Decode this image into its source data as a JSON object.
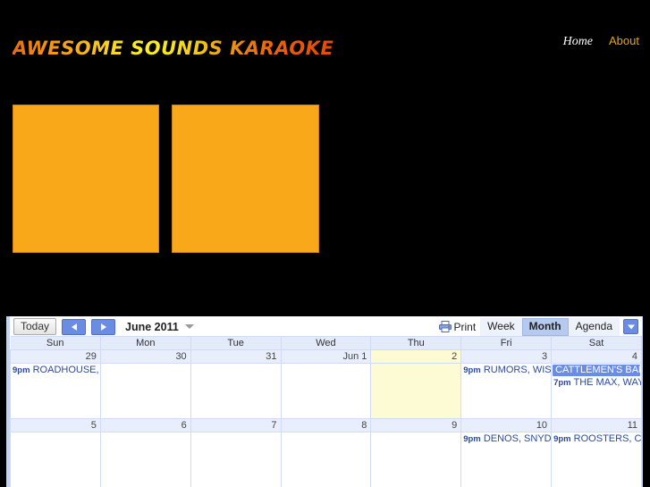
{
  "site": {
    "logo_text": "AWESOME SOUNDS KARAOKE",
    "logo_colors": {
      "orange": "#e85d0c",
      "yellow": "#fde21f"
    },
    "nav": [
      {
        "label": "Home",
        "name": "nav-link-home"
      },
      {
        "label": "About",
        "name": "nav-link-about"
      }
    ]
  },
  "banners": [
    {
      "name": "banner-placeholder-1",
      "color": "#f9a81a"
    },
    {
      "name": "banner-placeholder-2",
      "color": "#f9a81a"
    }
  ],
  "calendar": {
    "today_button": "Today",
    "prev_icon": "left-arrow-icon",
    "next_icon": "right-arrow-icon",
    "title": "June 2011",
    "title_caret_icon": "chevron-down-icon",
    "print_label": "Print",
    "print_icon": "printer-icon",
    "views": [
      {
        "label": "Week",
        "active": false
      },
      {
        "label": "Month",
        "active": true
      },
      {
        "label": "Agenda",
        "active": false
      }
    ],
    "agenda_caret_icon": "chevron-down-icon",
    "weekdays": [
      "Sun",
      "Mon",
      "Tue",
      "Wed",
      "Thu",
      "Fri",
      "Sat"
    ],
    "weeks": [
      {
        "days": [
          {
            "num": "29",
            "today": false,
            "events": [
              {
                "type": "timed",
                "time": "9pm",
                "title": "ROADHOUSE, W"
              }
            ]
          },
          {
            "num": "30",
            "today": false,
            "events": []
          },
          {
            "num": "31",
            "today": false,
            "events": []
          },
          {
            "num": "Jun 1",
            "today": false,
            "events": []
          },
          {
            "num": "2",
            "today": true,
            "events": []
          },
          {
            "num": "3",
            "today": false,
            "events": [
              {
                "type": "timed",
                "time": "9pm",
                "title": "RUMORS, WISN"
              }
            ]
          },
          {
            "num": "4",
            "today": false,
            "events": [
              {
                "type": "allday",
                "time": "",
                "title": "CATTLEMEN'S BALL"
              },
              {
                "type": "timed",
                "time": "7pm",
                "title": "THE MAX, WAYN"
              }
            ]
          }
        ]
      },
      {
        "days": [
          {
            "num": "5",
            "today": false,
            "events": []
          },
          {
            "num": "6",
            "today": false,
            "events": []
          },
          {
            "num": "7",
            "today": false,
            "events": []
          },
          {
            "num": "8",
            "today": false,
            "events": []
          },
          {
            "num": "9",
            "today": false,
            "events": []
          },
          {
            "num": "10",
            "today": false,
            "events": [
              {
                "type": "timed",
                "time": "9pm",
                "title": "DENOS, SNYDER"
              }
            ]
          },
          {
            "num": "11",
            "today": false,
            "events": [
              {
                "type": "timed",
                "time": "9pm",
                "title": "ROOSTERS, CA"
              }
            ]
          }
        ]
      }
    ]
  }
}
